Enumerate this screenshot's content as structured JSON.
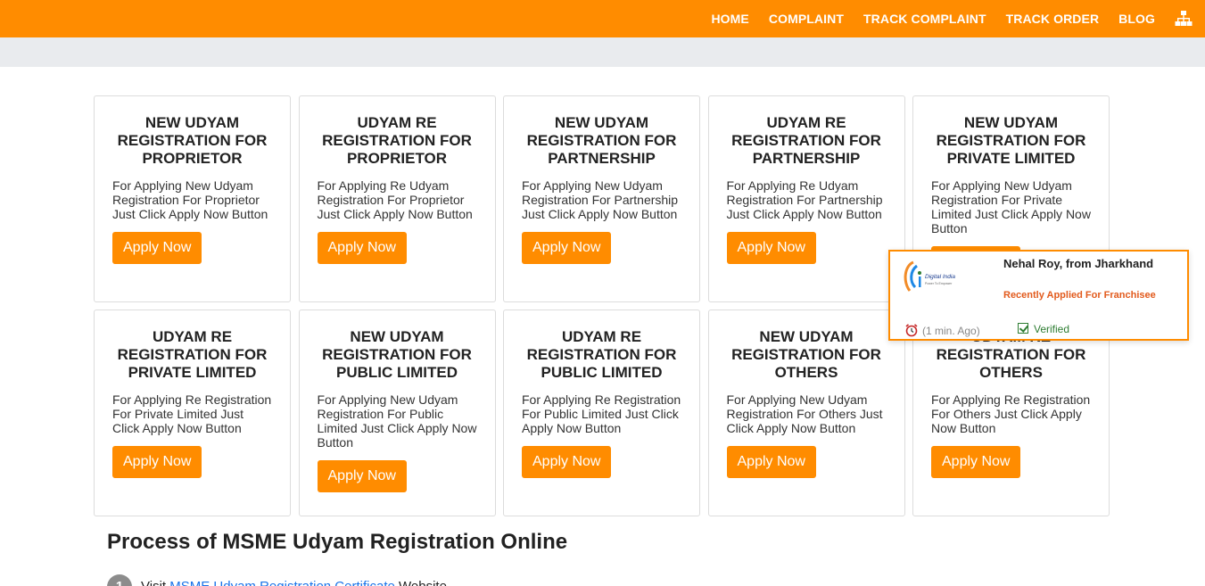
{
  "nav": {
    "items": [
      "HOME",
      "COMPLAINT",
      "TRACK COMPLAINT",
      "TRACK ORDER",
      "BLOG"
    ],
    "sitemap_icon": "sitemap-icon"
  },
  "colors": {
    "accent": "#ff8c00",
    "link": "#1a73e8",
    "alert_text": "#e25a1c",
    "verified": "#2e7d32"
  },
  "cards": [
    {
      "title": "NEW UDYAM REGISTRATION FOR PROPRIETOR",
      "desc": "For Applying New Udyam Registration For Proprietor Just Click Apply Now Button",
      "button": "Apply Now"
    },
    {
      "title": "UDYAM RE REGISTRATION FOR PROPRIETOR",
      "desc": "For Applying Re Udyam Registration For Proprietor Just Click Apply Now Button",
      "button": "Apply Now"
    },
    {
      "title": "NEW UDYAM REGISTRATION FOR PARTNERSHIP",
      "desc": "For Applying New Udyam Registration For Partnership Just Click Apply Now Button",
      "button": "Apply Now"
    },
    {
      "title": "UDYAM RE REGISTRATION FOR PARTNERSHIP",
      "desc": "For Applying Re Udyam Registration For Partnership Just Click Apply Now Button",
      "button": "Apply Now"
    },
    {
      "title": "NEW UDYAM REGISTRATION FOR PRIVATE LIMITED",
      "desc": "For Applying New Udyam Registration For Private Limited Just Click Apply Now Button",
      "button": "Apply Now"
    },
    {
      "title": "UDYAM RE REGISTRATION FOR PRIVATE LIMITED",
      "desc": "For Applying Re Registration For Private Limited Just Click Apply Now Button",
      "button": "Apply Now"
    },
    {
      "title": "NEW UDYAM REGISTRATION FOR PUBLIC LIMITED",
      "desc": "For Applying New Udyam Registration For Public Limited Just Click Apply Now Button",
      "button": "Apply Now"
    },
    {
      "title": "UDYAM RE REGISTRATION FOR PUBLIC LIMITED",
      "desc": "For Applying Re Registration For Public Limited Just Click Apply Now Button",
      "button": "Apply Now"
    },
    {
      "title": "NEW UDYAM REGISTRATION FOR OTHERS",
      "desc": "For Applying New Udyam Registration For Others Just Click Apply Now Button",
      "button": "Apply Now"
    },
    {
      "title": "UDYAM RE REGISTRATION FOR OTHERS",
      "desc": "For Applying Re Registration For Others Just Click Apply Now Button",
      "button": "Apply Now"
    }
  ],
  "process": {
    "title": "Process of MSME Udyam Registration Online",
    "step1_num": "1",
    "step1_prefix": "Visit",
    "step1_link": "MSME Udyam Registration Certificate",
    "step1_suffix": "Website"
  },
  "popup": {
    "name": "Nehal Roy, from Jharkhand",
    "message": "Recently Applied For Franchisee",
    "time": "(1 min. Ago)",
    "verified": "Verified",
    "logo_line1": "Digital India",
    "logo_line2": "Power To Empower"
  }
}
